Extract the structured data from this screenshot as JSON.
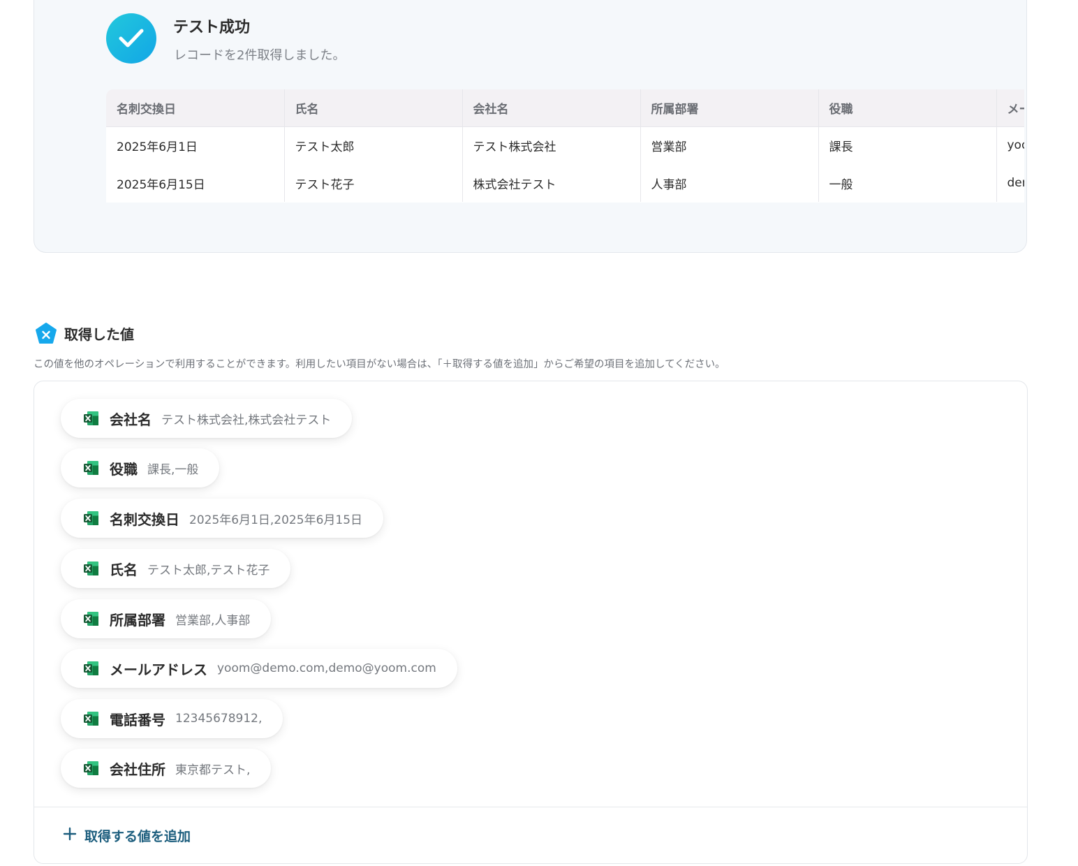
{
  "result": {
    "title": "テスト成功",
    "message": "レコードを2件取得しました。",
    "columns": [
      "名刺交換日",
      "氏名",
      "会社名",
      "所属部署",
      "役職",
      "メールアドレス"
    ],
    "rows": [
      [
        "2025年6月1日",
        "テスト太郎",
        "テスト株式会社",
        "営業部",
        "課長",
        "yoom@demo.com"
      ],
      [
        "2025年6月15日",
        "テスト花子",
        "株式会社テスト",
        "人事部",
        "一般",
        "demo@yoom.com"
      ]
    ]
  },
  "values_section": {
    "icon": "yoom-variable-icon",
    "title": "取得した値",
    "description": "この値を他のオペレーションで利用することができます。利用したい項目がない場合は、「＋取得する値を追加」からご希望の項目を追加してください。",
    "item_icon": "excel-icon",
    "items": [
      {
        "label": "会社名",
        "value": "テスト株式会社,株式会社テスト"
      },
      {
        "label": "役職",
        "value": "課長,一般"
      },
      {
        "label": "名刺交換日",
        "value": "2025年6月1日,2025年6月15日"
      },
      {
        "label": "氏名",
        "value": "テスト太郎,テスト花子"
      },
      {
        "label": "所属部署",
        "value": "営業部,人事部"
      },
      {
        "label": "メールアドレス",
        "value": "yoom@demo.com,demo@yoom.com"
      },
      {
        "label": "電話番号",
        "value": "12345678912,"
      },
      {
        "label": "会社住所",
        "value": "東京都テスト,"
      }
    ],
    "add_button_label": "取得する値を追加"
  },
  "colors": {
    "success_gradient_start": "#22c8dc",
    "success_gradient_end": "#12a6e6",
    "link": "#1b5d7d",
    "excel_green": "#1d6f42"
  }
}
